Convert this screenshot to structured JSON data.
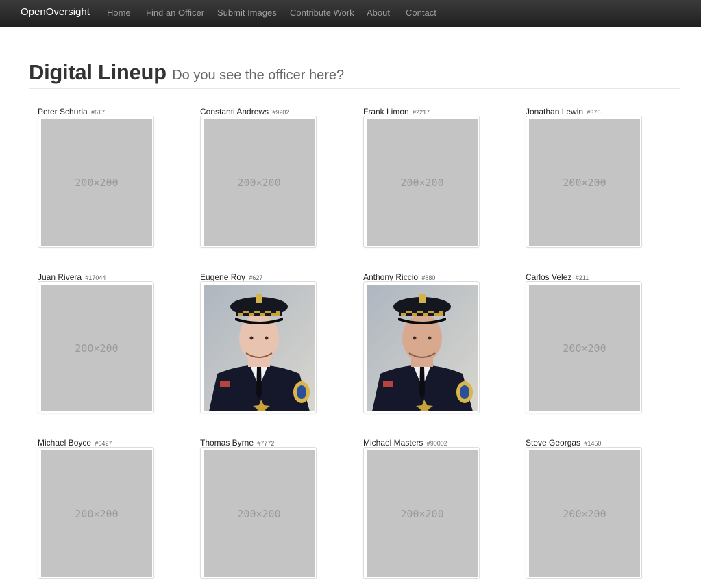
{
  "navbar": {
    "brand": "OpenOversight",
    "links": [
      "Home",
      "Find an Officer",
      "Submit Images",
      "Contribute Work",
      "About",
      "Contact"
    ]
  },
  "header": {
    "title": "Digital Lineup",
    "subtitle": "Do you see the officer here?"
  },
  "officers": [
    {
      "name": "Peter Schurla",
      "badge": "#617",
      "image": "200×200"
    },
    {
      "name": "Constanti Andrews",
      "badge": "#9202",
      "image": "200×200"
    },
    {
      "name": "Frank Limon",
      "badge": "#2217",
      "image": "200×200"
    },
    {
      "name": "Jonathan Lewin",
      "badge": "#370",
      "image": "200×200"
    },
    {
      "name": "Juan Rivera",
      "badge": "#17044",
      "image": "200×200"
    },
    {
      "name": "Eugene Roy",
      "badge": "#627",
      "image": "officer-photo"
    },
    {
      "name": "Anthony Riccio",
      "badge": "#880",
      "image": "officer-photo"
    },
    {
      "name": "Carlos Velez",
      "badge": "#211",
      "image": "200×200"
    },
    {
      "name": "Michael Boyce",
      "badge": "#6427",
      "image": "200×200"
    },
    {
      "name": "Thomas Byrne",
      "badge": "#7772",
      "image": "200×200"
    },
    {
      "name": "Michael Masters",
      "badge": "#90002",
      "image": "200×200"
    },
    {
      "name": "Steve Georgas",
      "badge": "#1450",
      "image": "200×200"
    }
  ]
}
